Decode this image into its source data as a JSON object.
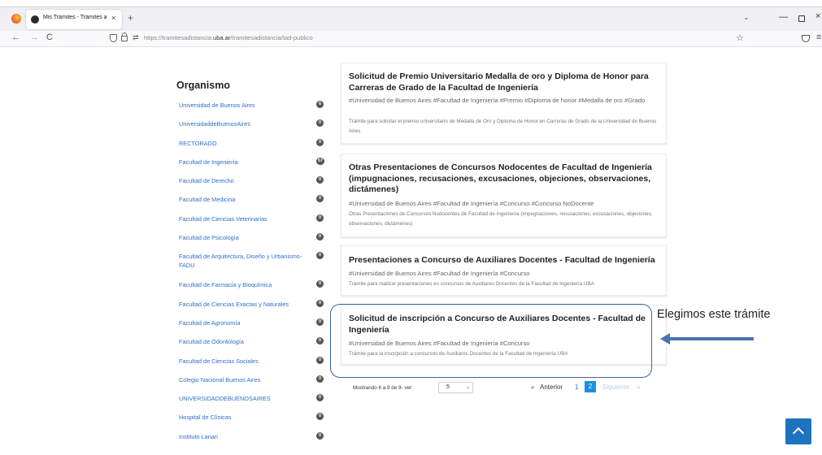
{
  "browser": {
    "tab_title": "Mis Trámites - Trámites a Distan",
    "tab_close": "×",
    "new_tab": "+",
    "url_prefix": "https://tramitesadistancia.",
    "url_domain": "uba.ar",
    "url_path": "/tramitesadistancia/tad-publico",
    "nav_back": "←",
    "nav_forward": "→",
    "nav_reload": "C",
    "perm_icon": "⇄",
    "bookmark": "☆",
    "tabs_list": "⌄",
    "win_min": "—",
    "win_close": "×",
    "menu": "≡"
  },
  "sidebar": {
    "title": "Organismo",
    "items": [
      {
        "label": "Universidad de Buenos Aires",
        "count": "6"
      },
      {
        "label": "UniversidaddeBuenosAires",
        "count": "0"
      },
      {
        "label": "RECTORADO",
        "count": "0"
      },
      {
        "label": "Facultad de Ingeniería",
        "count": "57"
      },
      {
        "label": "Facultad de Derecho",
        "count": "0"
      },
      {
        "label": "Facultad de Medicina",
        "count": "0"
      },
      {
        "label": "Facultad de Ciencias Veterinarias",
        "count": "0"
      },
      {
        "label": "Facultad de Psicología",
        "count": "0"
      },
      {
        "label": "Facultad de Arquitectura, Diseño y Urbanismo-FADU",
        "count": "0"
      },
      {
        "label": "Facultad de Farmacia y Bioquímica",
        "count": "0"
      },
      {
        "label": "Facultad de Ciencias Exactas y Naturales",
        "count": "0"
      },
      {
        "label": "Facultad de Agronomía",
        "count": "0"
      },
      {
        "label": "Facultad de Odontología",
        "count": "0"
      },
      {
        "label": "Facultad de Ciencias Sociales",
        "count": "0"
      },
      {
        "label": "Colegio Nacional Buenos Aires",
        "count": "0"
      },
      {
        "label": "UNIVERSIDADDEBUENOSAIRES",
        "count": "0"
      },
      {
        "label": "Hospital de Clínicas",
        "count": "0"
      },
      {
        "label": "Instituto Lanari",
        "count": "0"
      }
    ]
  },
  "cards": [
    {
      "title": "Solicitud de Premio Universitario Medalla de oro y Diploma de Honor para Carreras de Grado de la Facultad de Ingeniería",
      "tags": "#Universidad de Buenos Aires #Facultad de Ingeniería #Premio #Diploma de honor #Medalla de oro #Grado",
      "desc": "Trámite para solicitar el premio universitario de Medalla de Oro y Diploma de Honor en Carreras de Grado de la Universidad de Buenos Aires"
    },
    {
      "title": "Otras Presentaciones de Concursos Nodocentes de Facultad de Ingeniería (impugnaciones, recusaciones, excusaciones, objeciones, observaciones, dictámenes)",
      "tags": "#Universidad de Buenos Aires #Facultad de Ingeniería #Concurso #Concurso NoDocente",
      "desc": "Otras Presentaciones de Concursos Nodocentes de Facultad de Ingeniería (impugnaciones, recusaciones, excusaciones, objeciones, observaciones, dictámenes)"
    },
    {
      "title": "Presentaciones a Concurso de Auxiliares Docentes - Facultad de Ingeniería",
      "tags": "#Universidad de Buenos Aires #Facultad de Ingeniería #Concurso",
      "desc": "Trámite para realizar presentaciones en concursos de Auxiliares Docentes de la Facultad de Ingeniería UBA"
    },
    {
      "title": "Solicitud de inscripción a Concurso de Auxiliares Docentes - Facultad de Ingeniería",
      "tags": "#Universidad de Buenos Aires #Facultad de Ingeniería #Concurso",
      "desc": "Trámite para la inscripción a concursos de Auxiliares Docentes de la Facultad de Ingeniería UBA"
    }
  ],
  "annotation": {
    "text": "Elegimos este trámite",
    "color": "#4a72b3"
  },
  "pagination": {
    "showing": "Mostrando 6 a 9 de 9- ver:",
    "per_page": "5",
    "select_arrow": "⌄",
    "prev_chevron": "«",
    "prev": "Anterior",
    "page1": "1",
    "page2": "2",
    "next": "Siguiente",
    "next_chevron": "»"
  },
  "colors": {
    "link": "#2f6fc9",
    "active_page": "#1e90e0",
    "scroll_top": "#1e73be"
  }
}
